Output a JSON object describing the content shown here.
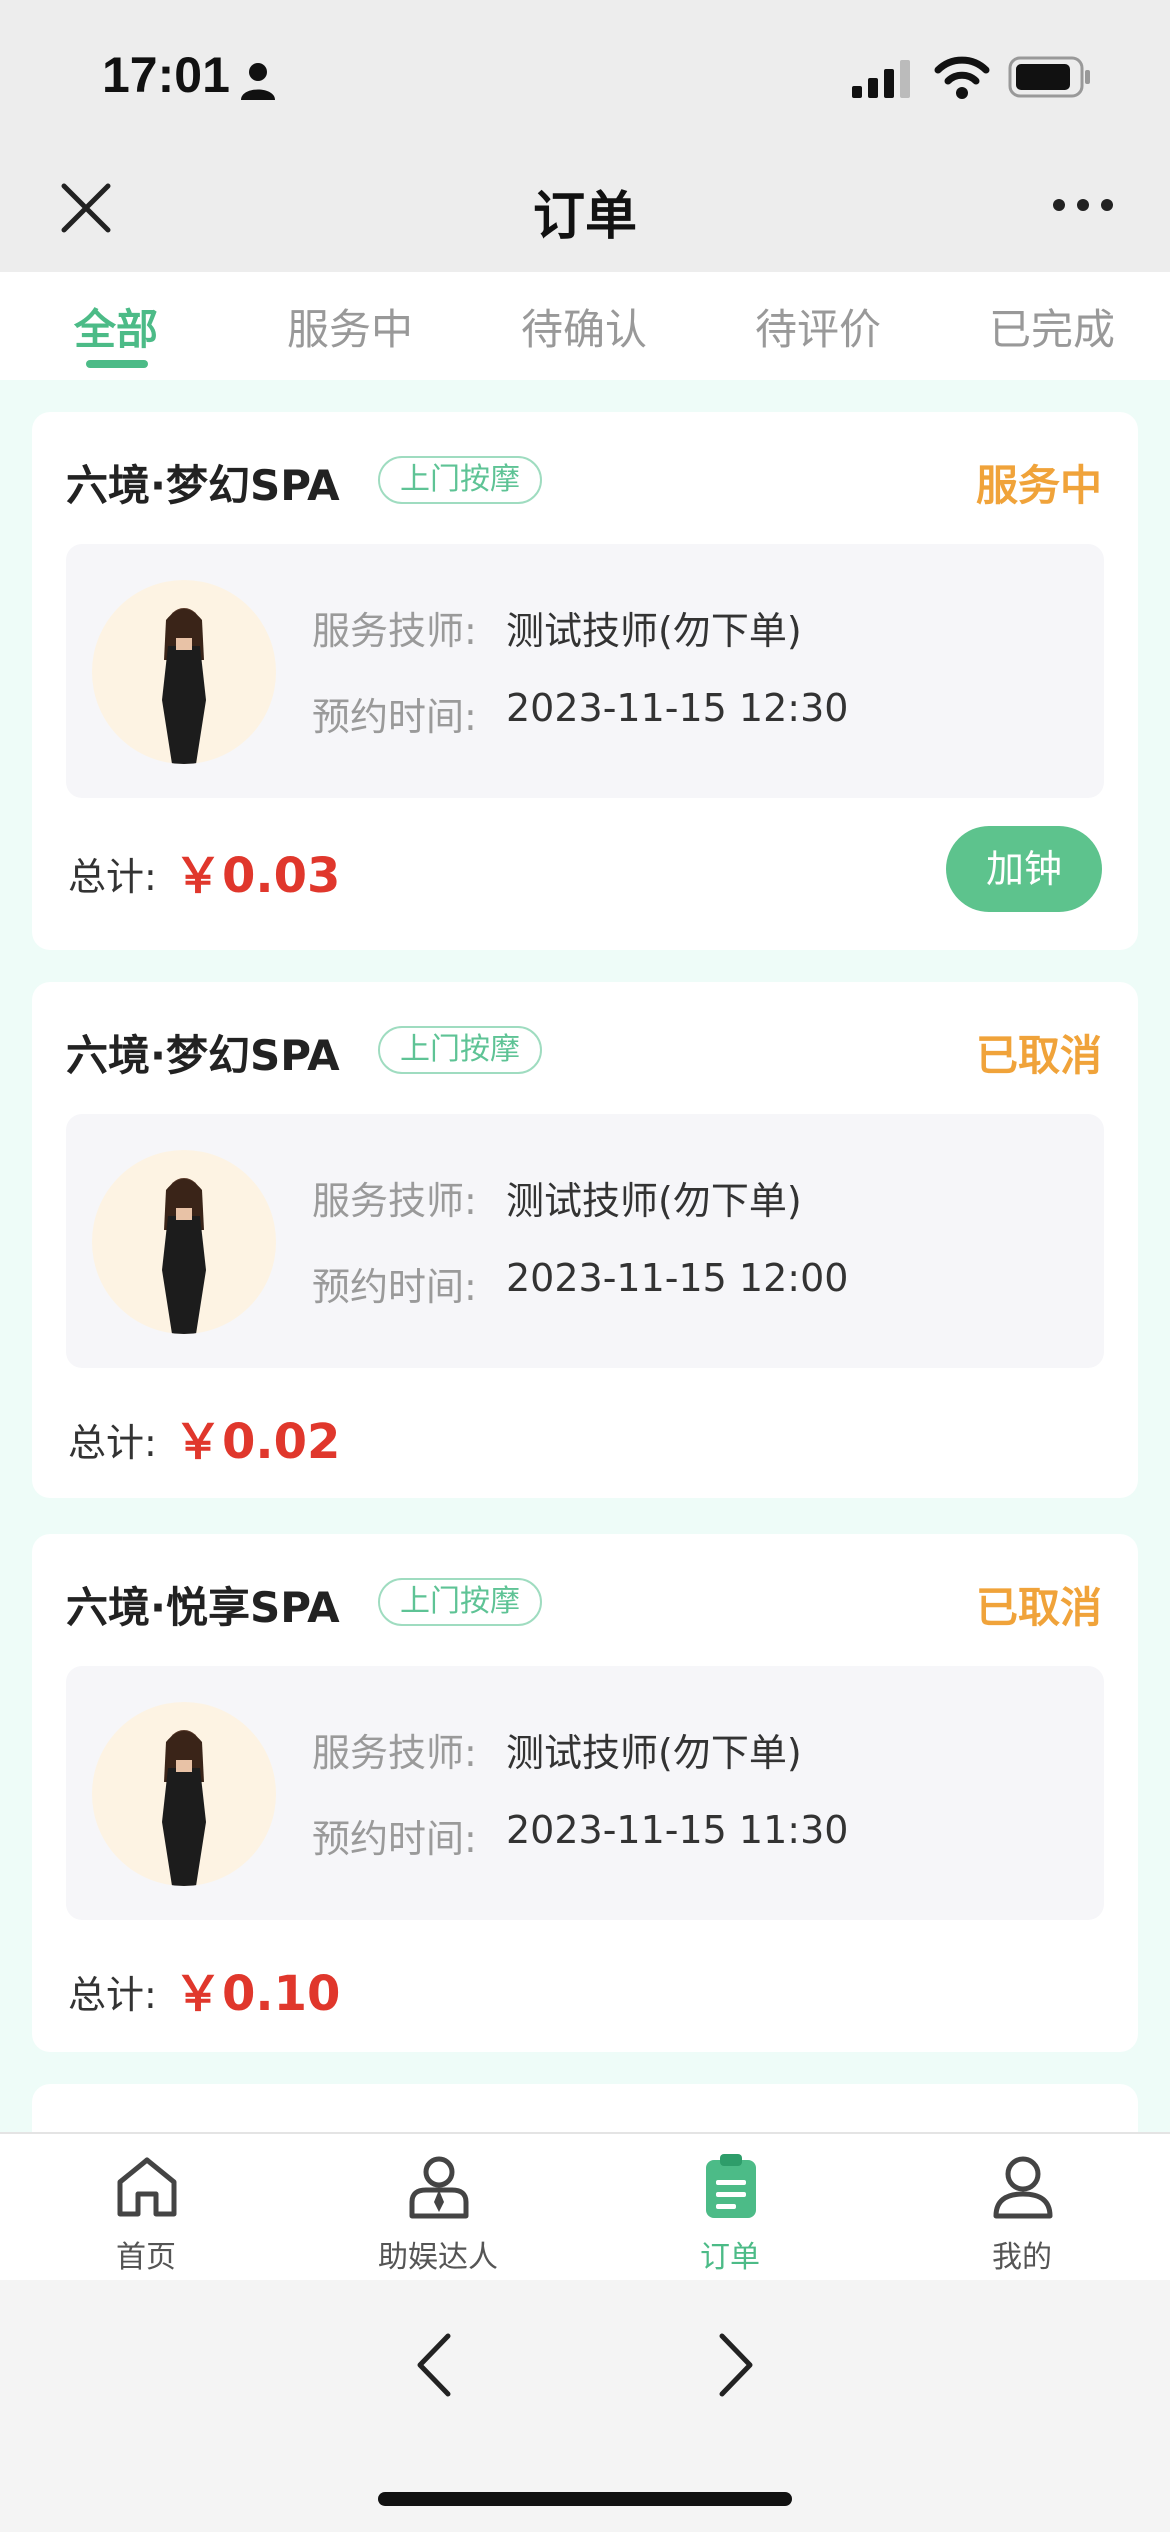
{
  "status_bar": {
    "time": "17:01",
    "icons": [
      "person-icon",
      "signal-icon",
      "wifi-icon",
      "battery-icon"
    ]
  },
  "nav": {
    "title": "订单",
    "left_icon": "close-icon",
    "right_icon": "more-icon"
  },
  "tabs": [
    {
      "label": "全部",
      "active": true
    },
    {
      "label": "服务中",
      "active": false
    },
    {
      "label": "待确认",
      "active": false
    },
    {
      "label": "待评价",
      "active": false
    },
    {
      "label": "已完成",
      "active": false
    }
  ],
  "orders": [
    {
      "shop": "六境·梦幻SPA",
      "tag": "上门按摩",
      "status": "服务中",
      "technician_label": "服务技师:",
      "technician": "测试技师(勿下单)",
      "time_label": "预约时间:",
      "time": "2023-11-15 12:30",
      "total_label": "总计:",
      "total": "￥0.03",
      "action": "加钟"
    },
    {
      "shop": "六境·梦幻SPA",
      "tag": "上门按摩",
      "status": "已取消",
      "technician_label": "服务技师:",
      "technician": "测试技师(勿下单)",
      "time_label": "预约时间:",
      "time": "2023-11-15 12:00",
      "total_label": "总计:",
      "total": "￥0.02"
    },
    {
      "shop": "六境·悦享SPA",
      "tag": "上门按摩",
      "status": "已取消",
      "technician_label": "服务技师:",
      "technician": "测试技师(勿下单)",
      "time_label": "预约时间:",
      "time": "2023-11-15 11:30",
      "total_label": "总计:",
      "total": "￥0.10"
    }
  ],
  "tabbar": [
    {
      "label": "首页",
      "icon": "home-icon",
      "active": false
    },
    {
      "label": "助娱达人",
      "icon": "expert-icon",
      "active": false
    },
    {
      "label": "订单",
      "icon": "order-clipboard-icon",
      "active": true
    },
    {
      "label": "我的",
      "icon": "profile-icon",
      "active": false
    }
  ],
  "colors": {
    "accent_green": "#4cbb87",
    "status_orange": "#f0a33a",
    "price_red": "#e0372c"
  }
}
